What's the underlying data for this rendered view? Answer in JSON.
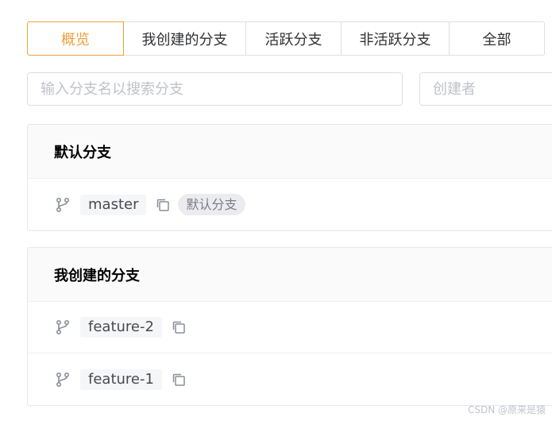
{
  "tabs": [
    {
      "label": "概览",
      "active": true
    },
    {
      "label": "我创建的分支",
      "active": false
    },
    {
      "label": "活跃分支",
      "active": false
    },
    {
      "label": "非活跃分支",
      "active": false
    },
    {
      "label": "全部",
      "active": false
    }
  ],
  "filters": {
    "search_placeholder": "输入分支名以搜索分支",
    "creator_placeholder": "创建者"
  },
  "sections": {
    "default": {
      "title": "默认分支",
      "branches": [
        {
          "name": "master",
          "tag": "默认分支"
        }
      ]
    },
    "mine": {
      "title": "我创建的分支",
      "branches": [
        {
          "name": "feature-2"
        },
        {
          "name": "feature-1"
        }
      ]
    }
  },
  "watermark": "CSDN @原来是猿",
  "colors": {
    "accent": "#f0a03c",
    "border": "#dcdfe6",
    "header_bg": "#fafafa"
  }
}
